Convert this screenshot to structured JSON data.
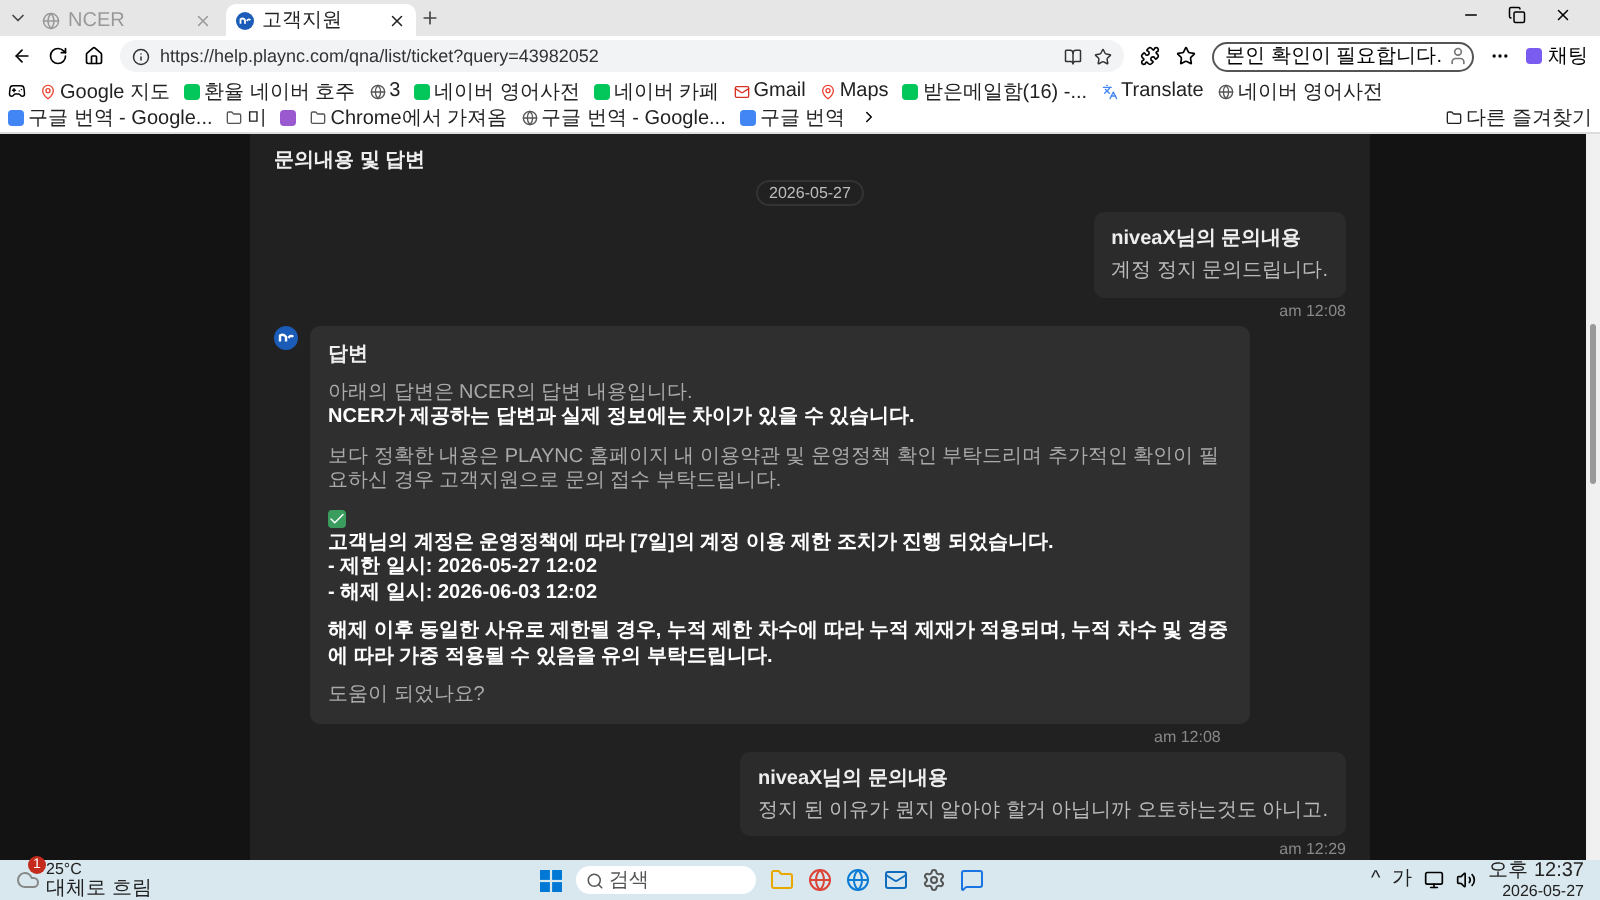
{
  "tabs": [
    {
      "title": "NCER",
      "selected": false
    },
    {
      "title": "고객지원",
      "selected": true
    }
  ],
  "address_bar": {
    "url": "https://help.plaync.com/qna/list/ticket?query=43982052"
  },
  "profile": {
    "label": "본인 확인이 필요합니다."
  },
  "copilot": {
    "label": "채팅"
  },
  "bookmarks": [
    {
      "label": "Google 지도"
    },
    {
      "label": "환율 네이버 호주"
    },
    {
      "label": "3"
    },
    {
      "label": "네이버 영어사전"
    },
    {
      "label": "네이버 카페"
    },
    {
      "label": "Gmail"
    },
    {
      "label": "Maps"
    },
    {
      "label": "받은메일함(16) -..."
    },
    {
      "label": "Translate"
    },
    {
      "label": "네이버 영어사전"
    },
    {
      "label": "구글 번역 - Google..."
    },
    {
      "label": "미"
    },
    {
      "label": "Chrome에서 가져옴"
    },
    {
      "label": "구글 번역 - Google..."
    },
    {
      "label": "구글 번역"
    }
  ],
  "other_bookmarks": {
    "label": "다른 즐겨찾기"
  },
  "section_title": "문의내용 및 답변",
  "date": "2026-05-27",
  "messages": [
    {
      "kind": "inquiry",
      "title": "niveaX님의 문의내용",
      "text": "계정 정지 문의드립니다.",
      "time": "am 12:08"
    },
    {
      "kind": "answer",
      "title": "답변",
      "time": "am 12:08",
      "footer": "도움이 되었나요?",
      "paragraphs": [
        {
          "kind": "note",
          "lines": [
            {
              "text": "아래의 답변은 NCER의 답변 내용입니다.",
              "strong": false
            },
            {
              "text": "NCER가 제공하는 답변과 실제 정보에는 차이가 있을 수 있습니다.",
              "strong": true
            }
          ]
        },
        {
          "kind": "note",
          "lines": [
            {
              "text": "보다 정확한 내용은 PLAYNC 홈페이지 내 이용약관 및 운영정책 확인 부탁드리며 추가적인 확인이 필요하신 경우 고객지원으로 문의 접수 부탁드립니다.",
              "strong": false
            }
          ]
        },
        {
          "kind": "checked_notice",
          "lines": [
            {
              "text": "고객님의 계정은 운영정책에 따라 [7일]의 계정 이용 제한 조치가 진행 되었습니다.",
              "strong": true
            },
            {
              "text": "- 제한 일시: 2026-05-27 12:02",
              "strong": true
            },
            {
              "text": "- 해제 일시: 2026-06-03 12:02",
              "strong": true
            }
          ]
        },
        {
          "kind": "note",
          "lines": [
            {
              "text": "해제 이후 동일한 사유로 제한될 경우, 누적 제한 차수에 따라 누적 제재가 적용되며, 누적 차수 및 경중에 따라 가중 적용될 수 있음을 유의 부탁드립니다.",
              "strong": true
            }
          ]
        }
      ]
    },
    {
      "kind": "inquiry",
      "title": "niveaX님의 문의내용",
      "text": "정지 된 이유가 뭔지 알아야 할거 아닙니까 오토하는것도 아니고.",
      "time": "am 12:29"
    }
  ],
  "taskbar": {
    "weather": {
      "temp": "25°C",
      "desc": "대체로 흐림",
      "badge": "1"
    },
    "search": {
      "placeholder": "검색"
    },
    "tray": {
      "chevron": "^",
      "ime": "가"
    },
    "clock": {
      "time": "오후 12:37",
      "date": "2026-05-27"
    }
  }
}
